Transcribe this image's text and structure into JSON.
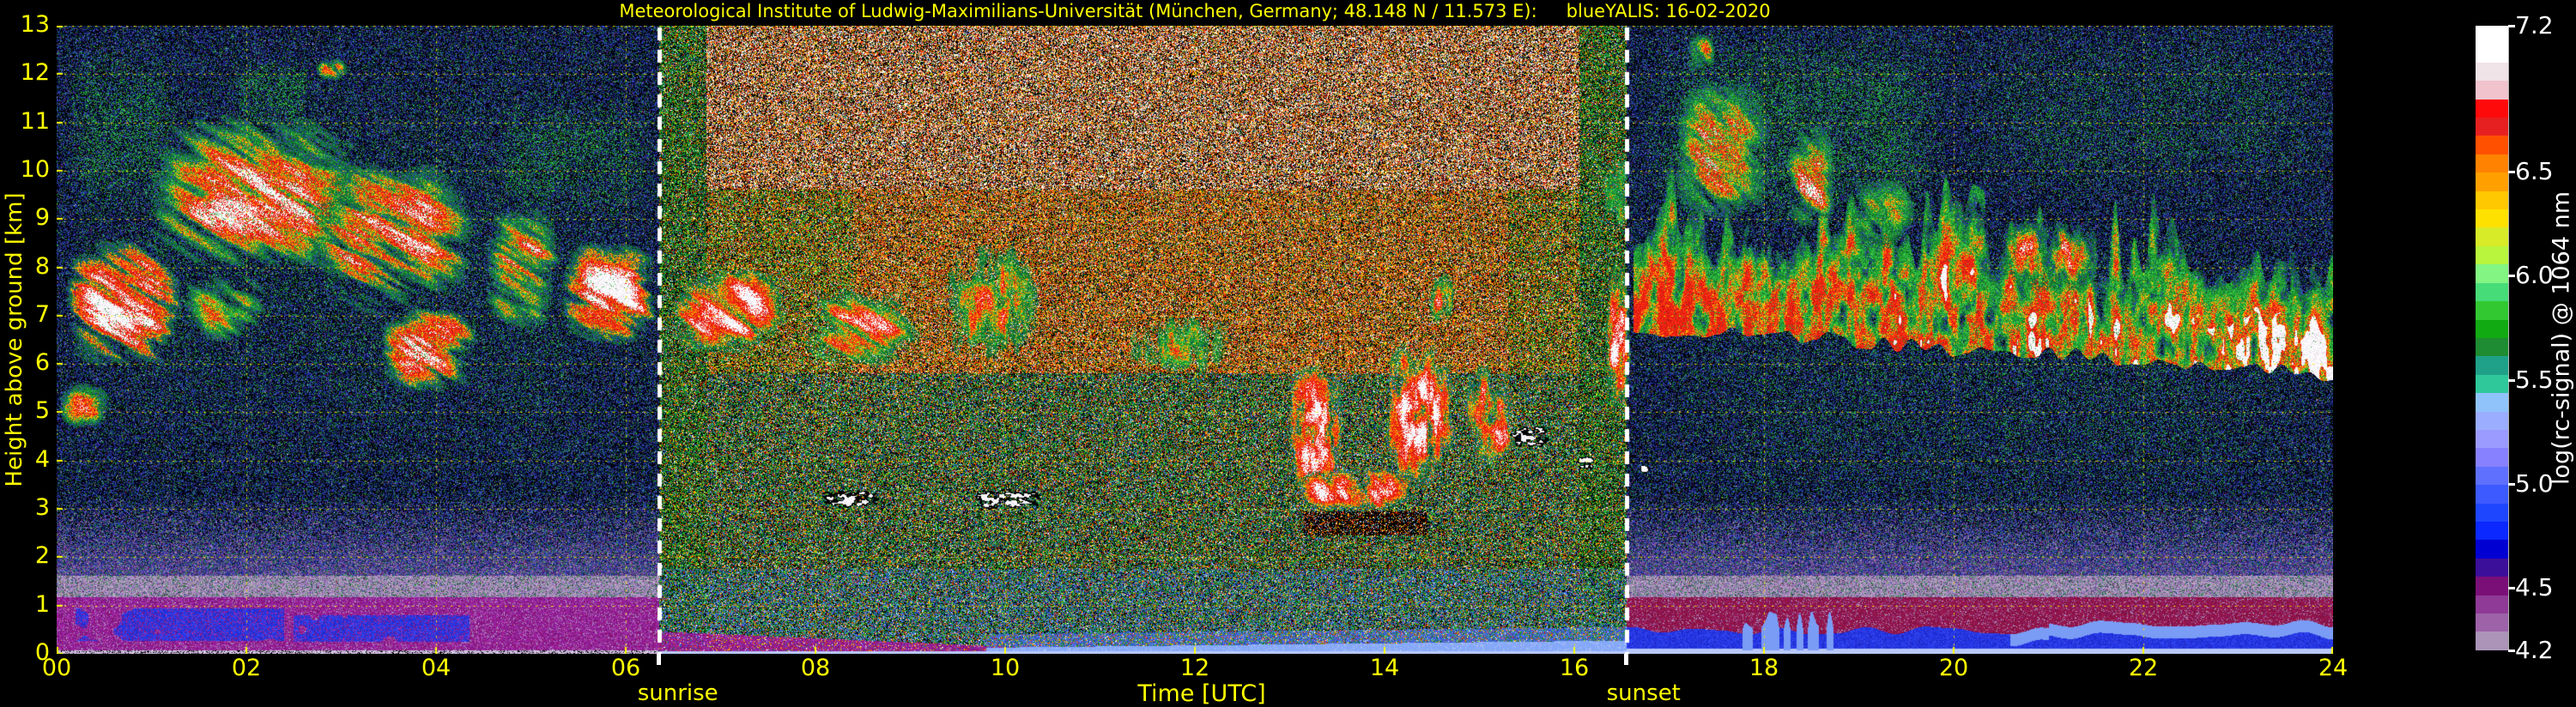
{
  "title": {
    "institute": "Meteorological Institute of Ludwig-Maximilians-Universität (München, Germany; 48.148 N / 11.573 E):",
    "run": "blueYALIS: 16-02-2020"
  },
  "colors": {
    "background": "#000000",
    "axis_text": "#ffff00",
    "grid": "rgba(250,230,0,0.9)",
    "sun_line": "#ffffff",
    "colorbar_text": "#ffffff"
  },
  "y_axis": {
    "label": "Height above ground [km]",
    "min": 0,
    "max": 13,
    "ticks": [
      {
        "label": "13",
        "value": 13
      },
      {
        "label": "12",
        "value": 12
      },
      {
        "label": "11",
        "value": 11
      },
      {
        "label": "10",
        "value": 10
      },
      {
        "label": "9",
        "value": 9
      },
      {
        "label": "8",
        "value": 8
      },
      {
        "label": "7",
        "value": 7
      },
      {
        "label": "6",
        "value": 6
      },
      {
        "label": "5",
        "value": 5
      },
      {
        "label": "4",
        "value": 4
      },
      {
        "label": "3",
        "value": 3
      },
      {
        "label": "2",
        "value": 2
      },
      {
        "label": "1",
        "value": 1
      },
      {
        "label": "0",
        "value": 0
      }
    ]
  },
  "x_axis": {
    "label": "Time [UTC]",
    "min": 0,
    "max": 24,
    "ticks": [
      {
        "label": "00",
        "value": 0
      },
      {
        "label": "02",
        "value": 2
      },
      {
        "label": "04",
        "value": 4
      },
      {
        "label": "06",
        "value": 6
      },
      {
        "label": "08",
        "value": 8
      },
      {
        "label": "10",
        "value": 10
      },
      {
        "label": "12",
        "value": 12
      },
      {
        "label": "14",
        "value": 14
      },
      {
        "label": "16",
        "value": 16
      },
      {
        "label": "18",
        "value": 18
      },
      {
        "label": "20",
        "value": 20
      },
      {
        "label": "22",
        "value": 22
      },
      {
        "label": "24",
        "value": 24
      }
    ]
  },
  "annotations": {
    "sunrise": {
      "label": "sunrise",
      "t": 6.35,
      "label_offset": 22
    },
    "sunset": {
      "label": "sunset",
      "t": 16.55,
      "label_offset": 20
    }
  },
  "colorbar": {
    "label": "log(rc-signal) @ 1064 nm",
    "min": 4.2,
    "max": 7.2,
    "tick_values": [
      {
        "label": "7.2",
        "value": 7.2
      },
      {
        "label": "6.5",
        "value": 6.5
      },
      {
        "label": "6.0",
        "value": 6.0
      },
      {
        "label": "5.5",
        "value": 5.5
      },
      {
        "label": "5.0",
        "value": 5.0
      },
      {
        "label": "4.5",
        "value": 4.5
      },
      {
        "label": "4.2",
        "value": 4.2
      }
    ],
    "colors_bottom_to_top": [
      "#ab94b8",
      "#9d62a8",
      "#8f3a96",
      "#7a0f78",
      "#3c0f9b",
      "#0000d2",
      "#0a28ff",
      "#1e46ff",
      "#3c5aff",
      "#5f70ff",
      "#8781ff",
      "#9b9bff",
      "#9badff",
      "#8fc3fa",
      "#2ec89b",
      "#1fa189",
      "#1e8c32",
      "#12aa12",
      "#32c832",
      "#46dc78",
      "#82f582",
      "#b9f53c",
      "#d7eb28",
      "#ffe100",
      "#ffc800",
      "#ffa000",
      "#ff8200",
      "#ff5000",
      "#e62020",
      "#ff0a0a",
      "#f0c3cd",
      "#f0e3e8",
      "#ffffff",
      "#ffffff"
    ]
  },
  "chart_data": {
    "type": "heatmap",
    "title": "Lidar range-corrected signal quicklook",
    "x": {
      "name": "Time [UTC]",
      "unit": "hours",
      "range": [
        0,
        24
      ],
      "grid_step": 2
    },
    "y": {
      "name": "Height above ground",
      "unit": "km",
      "range": [
        0,
        13
      ],
      "grid_step": 1
    },
    "value": {
      "name": "log(rc-signal) @ 1064 nm",
      "range": [
        4.2,
        7.2
      ]
    },
    "day": {
      "sunrise": 6.35,
      "sunset": 16.55
    },
    "legend_position": "right",
    "grid": "yellow dotted",
    "palettes": {
      "night": [
        [
          "#000008",
          0.42
        ],
        [
          "#0c1444",
          0.13
        ],
        [
          "#1a2a90",
          0.12
        ],
        [
          "#2c42be",
          0.095
        ],
        [
          "#4a5ccc",
          0.045
        ],
        [
          "#1a6632",
          0.075
        ],
        [
          "#2aa348",
          0.04
        ],
        [
          "#155040",
          0.025
        ],
        [
          "#54287e",
          0.018
        ],
        [
          "#6e2054",
          0.012
        ],
        [
          "#7e2020",
          0.007
        ],
        [
          "#b4b422",
          0.003
        ],
        [
          "#cccccc",
          0.002
        ]
      ],
      "day_top": [
        [
          "#000000",
          0.3
        ],
        [
          "#ffffff",
          0.2
        ],
        [
          "#e02010",
          0.11
        ],
        [
          "#ff6c00",
          0.1
        ],
        [
          "#d2aa64",
          0.09
        ],
        [
          "#c87828",
          0.05
        ],
        [
          "#ffd200",
          0.05
        ],
        [
          "#1e8c28",
          0.05
        ],
        [
          "#a0a0a0",
          0.03
        ],
        [
          "#2846c8",
          0.02
        ]
      ],
      "day_core": [
        [
          "#000000",
          0.26
        ],
        [
          "#e02010",
          0.13
        ],
        [
          "#ff6c00",
          0.15
        ],
        [
          "#c87828",
          0.09
        ],
        [
          "#d2aa64",
          0.08
        ],
        [
          "#ffd200",
          0.08
        ],
        [
          "#1e8c28",
          0.1
        ],
        [
          "#ffffff",
          0.07
        ],
        [
          "#0f5a1e",
          0.04
        ],
        [
          "#2846c8",
          0.02
        ]
      ],
      "day_gmid": [
        [
          "#000000",
          0.27
        ],
        [
          "#1e9628",
          0.16
        ],
        [
          "#ff6c00",
          0.12
        ],
        [
          "#e02010",
          0.1
        ],
        [
          "#32c83c",
          0.08
        ],
        [
          "#ffd200",
          0.08
        ],
        [
          "#0f5a1e",
          0.06
        ],
        [
          "#ffffff",
          0.06
        ],
        [
          "#c87828",
          0.04
        ],
        [
          "#2846c8",
          0.03
        ]
      ],
      "day_edge": [
        [
          "#000000",
          0.3
        ],
        [
          "#1e9628",
          0.22
        ],
        [
          "#0f5a1e",
          0.1
        ],
        [
          "#32c83c",
          0.09
        ],
        [
          "#ffd200",
          0.05
        ],
        [
          "#e02010",
          0.05
        ],
        [
          "#ff6c00",
          0.05
        ],
        [
          "#ffffff",
          0.04
        ],
        [
          "#2846c8",
          0.05
        ],
        [
          "#1e8c82",
          0.03
        ]
      ],
      "day_low": [
        [
          "#000000",
          0.28
        ],
        [
          "#1e9628",
          0.16
        ],
        [
          "#0f5a1e",
          0.08
        ],
        [
          "#32c83c",
          0.07
        ],
        [
          "#2846c8",
          0.08
        ],
        [
          "#1e8c82",
          0.05
        ],
        [
          "#6aa0f0",
          0.04
        ],
        [
          "#e02010",
          0.07
        ],
        [
          "#ff6c00",
          0.06
        ],
        [
          "#ffd200",
          0.05
        ],
        [
          "#ffffff",
          0.04
        ]
      ],
      "daylowmix": [
        [
          "#2846c8",
          0.3
        ],
        [
          "#4668e0",
          0.25
        ],
        [
          "#1e9628",
          0.25
        ],
        [
          "#6aa0f0",
          0.2
        ]
      ],
      "magenta": [
        [
          "#8c1e96",
          0.3
        ],
        [
          "#a028aa",
          0.25
        ],
        [
          "#7a1478",
          0.2
        ],
        [
          "#960f6e",
          0.15
        ],
        [
          "#b43cb4",
          0.1
        ]
      ],
      "crimson": [
        [
          "#8c1446",
          0.35
        ],
        [
          "#a01850",
          0.3
        ],
        [
          "#7a1040",
          0.2
        ],
        [
          "#961e6e",
          0.15
        ]
      ],
      "mauve": [
        [
          "#a48fb4",
          0.3
        ],
        [
          "#b49ec3",
          0.25
        ],
        [
          "#9678b4",
          0.2
        ],
        [
          "#8c64aa",
          0.15
        ],
        [
          "#c8b4d2",
          0.1
        ]
      ],
      "pfade": [
        [
          "#6a4090",
          0.3
        ],
        [
          "#8c64aa",
          0.3
        ],
        [
          "#50287c",
          0.25
        ],
        [
          "#a48fb4",
          0.15
        ]
      ],
      "vblues": [
        [
          "#2336e8",
          0.4
        ],
        [
          "#3448f0",
          0.3
        ],
        [
          "#1e28c8",
          0.3
        ]
      ],
      "groundline": [
        [
          "#cfc0dd",
          0.45
        ],
        [
          "#b8a8cc",
          0.3
        ],
        [
          "#e8e0f0",
          0.15
        ],
        [
          "#9a88b0",
          0.1
        ]
      ],
      "greens": [
        [
          "#1e9628",
          0.3
        ],
        [
          "#2ab43c",
          0.3
        ],
        [
          "#147828",
          0.2
        ],
        [
          "#3cd250",
          0.2
        ]
      ],
      "whites": [
        [
          "#ffffff",
          0.6
        ],
        [
          "#f2eef2",
          0.25
        ],
        [
          "#e4d8e4",
          0.15
        ]
      ],
      "reds": [
        [
          "#e61e10",
          0.45
        ],
        [
          "#ff3214",
          0.35
        ],
        [
          "#c81414",
          0.2
        ]
      ],
      "oranges": [
        [
          "#ff7d00",
          0.45
        ],
        [
          "#ffd200",
          0.3
        ],
        [
          "#ff9e1e",
          0.25
        ]
      ],
      "dgreens": [
        [
          "#0f6e28",
          0.4
        ],
        [
          "#147850",
          0.3
        ],
        [
          "#126032",
          0.3
        ]
      ]
    },
    "features": [
      {
        "type": "cloud",
        "t0": 0.05,
        "t1": 1.4,
        "h0": 5.7,
        "h1": 8.9,
        "hot": 0.95,
        "slant": 1.6,
        "d": 1.15,
        "sd": 21
      },
      {
        "type": "cloud",
        "t0": 0.0,
        "t1": 0.6,
        "h0": 4.6,
        "h1": 5.7,
        "hot": 0.55,
        "slant": 1.2,
        "d": 0.9,
        "sd": 22
      },
      {
        "type": "cloud",
        "t0": 0.85,
        "t1": 3.4,
        "h0": 7.7,
        "h1": 11.4,
        "hot": 0.6,
        "slant": 1.5,
        "d": 1.05,
        "sd": 23
      },
      {
        "type": "cloud",
        "t0": 1.25,
        "t1": 2.3,
        "h0": 6.3,
        "h1": 8.0,
        "hot": 0.3,
        "slant": 1.2,
        "d": 0.85,
        "sd": 24
      },
      {
        "type": "cloud",
        "t0": 2.55,
        "t1": 4.5,
        "h0": 6.8,
        "h1": 10.4,
        "hot": 0.72,
        "slant": 1.8,
        "d": 1.0,
        "sd": 25
      },
      {
        "type": "cloud",
        "t0": 3.35,
        "t1": 4.5,
        "h0": 5.3,
        "h1": 7.3,
        "hot": 0.85,
        "slant": 1.4,
        "d": 1.0,
        "sd": 26
      },
      {
        "type": "cloud",
        "t0": 4.45,
        "t1": 5.35,
        "h0": 6.5,
        "h1": 9.4,
        "hot": 0.62,
        "slant": 1.6,
        "d": 0.95,
        "sd": 27
      },
      {
        "type": "cloud",
        "t0": 5.25,
        "t1": 6.4,
        "h0": 6.2,
        "h1": 8.7,
        "hot": 0.92,
        "slant": 1.5,
        "d": 1.1,
        "sd": 28
      },
      {
        "type": "cloud",
        "t0": 2.7,
        "t1": 3.1,
        "h0": 11.8,
        "h1": 12.4,
        "hot": 0.65,
        "slant": 1.0,
        "d": 0.9,
        "sd": 29
      },
      {
        "type": "greenspeckle",
        "t0": 0.1,
        "t1": 1.3,
        "h0": 8.9,
        "h1": 12.7,
        "d": 0.3,
        "sd": 30
      },
      {
        "type": "greenspeckle",
        "t0": 1.8,
        "t1": 2.7,
        "h0": 10.8,
        "h1": 12.4,
        "d": 0.35,
        "sd": 31
      },
      {
        "type": "greenspeckle",
        "t0": 4.5,
        "t1": 6.35,
        "h0": 8.8,
        "h1": 11.6,
        "d": 0.3,
        "sd": 32
      },
      {
        "type": "greenspeckle",
        "t0": 0.0,
        "t1": 6.35,
        "h0": 3.2,
        "h1": 13.0,
        "d": 0.1,
        "sd": 33
      },
      {
        "type": "cloud",
        "t0": 6.4,
        "t1": 7.75,
        "h0": 6.1,
        "h1": 8.1,
        "hot": 0.9,
        "slant": 1.3,
        "d": 1.1,
        "sd": 34
      },
      {
        "type": "cloud",
        "t0": 7.75,
        "t1": 9.25,
        "h0": 5.8,
        "h1": 7.7,
        "hot": 0.62,
        "slant": 1.6,
        "d": 0.9,
        "sd": 35
      },
      {
        "type": "column",
        "t0": 9.25,
        "t1": 10.45,
        "h0": 5.8,
        "h1": 8.7,
        "hot": 0.55,
        "d": 0.75,
        "sd": 36
      },
      {
        "type": "thincloud",
        "t0": 7.95,
        "t1": 8.8,
        "h0": 2.95,
        "h1": 3.45,
        "sd": 37
      },
      {
        "type": "thincloud",
        "t0": 9.5,
        "t1": 10.5,
        "h0": 2.9,
        "h1": 3.5,
        "sd": 38
      },
      {
        "type": "column",
        "t0": 11.15,
        "t1": 12.5,
        "h0": 5.6,
        "h1": 7.2,
        "hot": 0.35,
        "d": 0.6,
        "sd": 39
      },
      {
        "type": "column",
        "t0": 12.95,
        "t1": 13.6,
        "h0": 3.0,
        "h1": 6.2,
        "hot": 0.96,
        "d": 1.15,
        "sd": 40
      },
      {
        "type": "cloud",
        "t0": 13.05,
        "t1": 14.4,
        "h0": 2.9,
        "h1": 3.9,
        "hot": 0.97,
        "slant": 0.5,
        "d": 1.25,
        "sd": 41
      },
      {
        "type": "shadow",
        "t0": 13.15,
        "t1": 14.45,
        "h0": 2.45,
        "h1": 2.95,
        "sd": 42
      },
      {
        "type": "column",
        "t0": 13.95,
        "t1": 14.8,
        "h0": 3.2,
        "h1": 6.7,
        "hot": 0.95,
        "d": 1.1,
        "sd": 43
      },
      {
        "type": "column",
        "t0": 14.45,
        "t1": 14.75,
        "h0": 6.7,
        "h1": 8.0,
        "hot": 0.7,
        "d": 0.8,
        "sd": 44
      },
      {
        "type": "column",
        "t0": 14.8,
        "t1": 15.45,
        "h0": 3.5,
        "h1": 6.3,
        "hot": 0.8,
        "d": 0.85,
        "sd": 45
      },
      {
        "type": "thincloud",
        "t0": 15.25,
        "t1": 15.8,
        "h0": 4.1,
        "h1": 4.85,
        "sd": 46
      },
      {
        "type": "thincloud",
        "t0": 16.0,
        "t1": 16.25,
        "h0": 3.75,
        "h1": 4.15,
        "sd": 47
      },
      {
        "type": "column",
        "t0": 16.3,
        "t1": 16.62,
        "h0": 4.8,
        "h1": 8.4,
        "hot": 0.85,
        "d": 1.0,
        "sd": 48
      },
      {
        "type": "column",
        "t0": 16.25,
        "t1": 16.62,
        "h0": 8.4,
        "h1": 10.6,
        "hot": 0.35,
        "d": 0.6,
        "sd": 49
      },
      {
        "type": "eveningband",
        "t0": 16.62,
        "t1": 24.0,
        "h0": 4.5,
        "h1": 10.5,
        "sd": 50
      },
      {
        "type": "cloud",
        "t0": 16.95,
        "t1": 18.15,
        "h0": 8.7,
        "h1": 12.1,
        "hot": 0.55,
        "slant": 0.8,
        "d": 0.95,
        "sd": 51
      },
      {
        "type": "cloud",
        "t0": 17.15,
        "t1": 17.5,
        "h0": 11.9,
        "h1": 12.9,
        "hot": 0.35,
        "slant": 0.6,
        "d": 0.9,
        "sd": 52
      },
      {
        "type": "cloud",
        "t0": 18.2,
        "t1": 18.8,
        "h0": 8.6,
        "h1": 11.1,
        "hot": 0.6,
        "slant": 0.8,
        "d": 0.95,
        "sd": 53
      },
      {
        "type": "cloud",
        "t0": 18.85,
        "t1": 19.65,
        "h0": 8.2,
        "h1": 10.0,
        "hot": 0.3,
        "slant": 0.8,
        "d": 0.8,
        "sd": 54
      },
      {
        "type": "column",
        "t0": 20.35,
        "t1": 21.65,
        "h0": 7.3,
        "h1": 9.1,
        "hot": 0.6,
        "d": 0.8,
        "sd": 55
      },
      {
        "type": "greenspeckle",
        "t0": 16.7,
        "t1": 20.0,
        "h0": 8.8,
        "h1": 13.0,
        "d": 0.33,
        "sd": 56
      },
      {
        "type": "greenspeckle",
        "t0": 20.0,
        "t1": 24.0,
        "h0": 9.3,
        "h1": 13.0,
        "d": 0.15,
        "sd": 57
      },
      {
        "type": "greenspeckle",
        "t0": 16.62,
        "t1": 24.0,
        "h0": 2.5,
        "h1": 9.0,
        "d": 0.1,
        "sd": 58
      },
      {
        "type": "thincloud",
        "t0": 16.68,
        "t1": 16.8,
        "h0": 3.7,
        "h1": 3.95,
        "sd": 59
      }
    ]
  }
}
